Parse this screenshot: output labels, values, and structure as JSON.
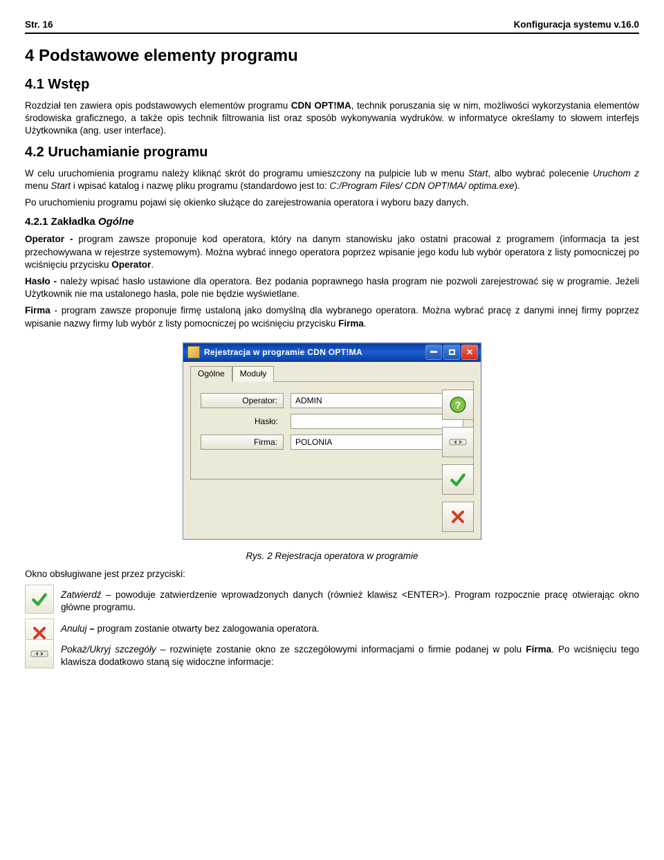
{
  "header": {
    "left": "Str. 16",
    "right": "Konfiguracja systemu v.16.0"
  },
  "h1": "4  Podstawowe elementy programu",
  "h2_intro": "4.1  Wstęp",
  "intro_pre": "Rozdział ten zawiera opis podstawowych elementów programu ",
  "intro_b": "CDN OPT!MA",
  "intro_post": ", technik poruszania się w nim, możliwości wykorzystania elementów środowiska graficznego, a także opis technik filtrowania list oraz sposób wykonywania wydruków. w informatyce określamy to słowem interfejs Użytkownika (ang. user interface).",
  "h2_launch": "4.2  Uruchamianie programu",
  "launch_p1_a": "W celu uruchomienia programu należy kliknąć skrót do programu umieszczony na pulpicie lub w menu ",
  "launch_p1_b": "Start",
  "launch_p1_c": ", albo wybrać polecenie ",
  "launch_p1_d": "Uruchom z",
  "launch_p1_e": " menu ",
  "launch_p1_f": "Start",
  "launch_p1_g": " i wpisać katalog i nazwę pliku programu (standardowo jest to: ",
  "launch_p1_h": "C:/Program Files/ CDN OPT!MA/ optima.exe",
  "launch_p1_i": ").",
  "launch_p2": "Po uruchomieniu programu pojawi się okienko służące do zarejestrowania operatora i wyboru bazy danych.",
  "h3_tab": "4.2.1   Zakładka ",
  "h3_tab_i": "Ogólne",
  "op_b": "Operator - ",
  "op_t": "program zawsze proponuje kod operatora, który na danym stanowisku jako ostatni pracował z programem (informacja ta jest przechowywana w rejestrze systemowym). Można wybrać innego operatora poprzez wpisanie jego kodu lub wybór operatora z listy pomocniczej po wciśnięciu przycisku ",
  "op_b2": "Operator",
  "op_t2": ".",
  "pw_b": "Hasło - ",
  "pw_t": " należy wpisać hasło ustawione dla operatora. Bez podania poprawnego hasła program nie pozwoli zarejestrować się w programie. Jeżeli Użytkownik nie ma ustalonego hasła, pole nie będzie wyświetlane.",
  "fm_b": "Firma",
  "fm_t": " - program zawsze proponuje firmę ustaloną jako domyślną dla wybranego operatora. Można wybrać pracę z danymi innej firmy poprzez wpisanie nazwy firmy lub wybór z listy pomocniczej po wciśnięciu przycisku ",
  "fm_b2": "Firma",
  "fm_t2": ".",
  "dialog": {
    "title": "Rejestracja w programie CDN OPT!MA",
    "tabs": {
      "general": "Ogólne",
      "modules": "Moduły"
    },
    "labels": {
      "operator": "Operator:",
      "password": "Hasło:",
      "company": "Firma:"
    },
    "values": {
      "operator": "ADMIN",
      "password": "",
      "company": "POLONIA"
    }
  },
  "figcaption": "Rys. 2 Rejestracja operatora w programie",
  "after1": "Okno obsługiwane jest przez przyciski:",
  "confirm_i": "Zatwierdź",
  "confirm_t": " – powoduje zatwierdzenie wprowadzonych danych (również klawisz <ENTER>). Program rozpocznie pracę otwierając okno główne programu.",
  "cancel_i": "Anuluj ",
  "cancel_b": "–",
  "cancel_t": " program zostanie otwarty bez zalogowania operatora.",
  "toggle_i": "Pokaż/Ukryj szczegóły",
  "toggle_t": " – rozwinięte zostanie okno ze szczegółowymi informacjami o firmie podanej w polu ",
  "toggle_b": "Firma",
  "toggle_t2": ". Po wciśnięciu tego klawisza dodatkowo staną się widoczne informacje:"
}
